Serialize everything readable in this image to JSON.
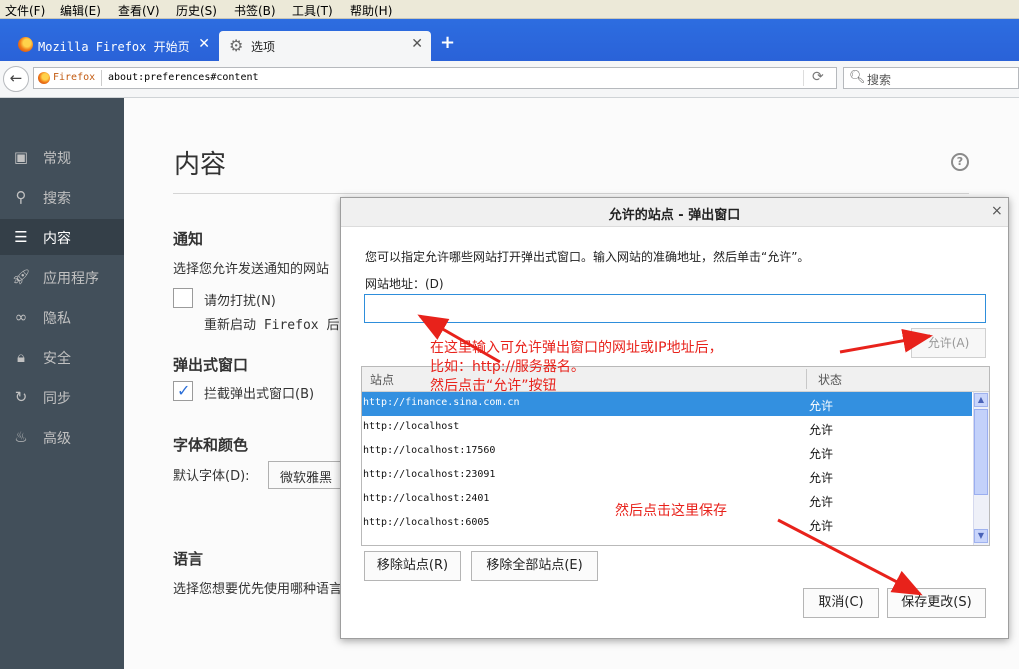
{
  "menubar": [
    "文件(F)",
    "编辑(E)",
    "查看(V)",
    "历史(S)",
    "书签(B)",
    "工具(T)",
    "帮助(H)"
  ],
  "tabs": [
    {
      "label": "Mozilla Firefox 开始页",
      "close": "✕"
    },
    {
      "label": "选项",
      "close": "✕"
    }
  ],
  "new_tab": "+",
  "navbar": {
    "identity": "Firefox",
    "url": "about:preferences#content",
    "search_placeholder": "搜索"
  },
  "sidebar": {
    "items": [
      {
        "label": "常规",
        "icon": "general-icon"
      },
      {
        "label": "搜索",
        "icon": "search-icon"
      },
      {
        "label": "内容",
        "icon": "content-icon",
        "active": true
      },
      {
        "label": "应用程序",
        "icon": "applications-icon"
      },
      {
        "label": "隐私",
        "icon": "privacy-mask-icon"
      },
      {
        "label": "安全",
        "icon": "lock-icon"
      },
      {
        "label": "同步",
        "icon": "sync-icon"
      },
      {
        "label": "高级",
        "icon": "advanced-icon"
      }
    ]
  },
  "content": {
    "title": "内容",
    "help": "?",
    "notifications": {
      "heading": "通知",
      "desc": "选择您允许发送通知的网站",
      "dnd_label": "请勿打扰(N)",
      "dnd_note": "重新启动 Firefox 后"
    },
    "popups": {
      "heading": "弹出式窗口",
      "block_label": "拦截弹出式窗口(B)"
    },
    "fonts": {
      "heading": "字体和颜色",
      "default_font_label": "默认字体(D):",
      "default_font_value": "微软雅黑"
    },
    "language": {
      "heading": "语言",
      "desc": "选择您想要优先使用哪种语言"
    }
  },
  "dialog": {
    "title": "允许的站点 - 弹出窗口",
    "close": "×",
    "description": "您可以指定允许哪些网站打开弹出式窗口。输入网站的准确地址，然后单击“允许”。",
    "address_label": "网站地址：(D)",
    "address_value": "",
    "allow_button": "允许(A)",
    "columns": [
      "站点",
      "状态"
    ],
    "rows": [
      {
        "site": "http://finance.sina.com.cn",
        "status": "允许",
        "selected": true
      },
      {
        "site": "http://localhost",
        "status": "允许"
      },
      {
        "site": "http://localhost:17560",
        "status": "允许"
      },
      {
        "site": "http://localhost:23091",
        "status": "允许"
      },
      {
        "site": "http://localhost:2401",
        "status": "允许"
      },
      {
        "site": "http://localhost:6005",
        "status": "允许"
      }
    ],
    "remove_button": "移除站点(R)",
    "remove_all_button": "移除全部站点(E)",
    "cancel_button": "取消(C)",
    "save_button": "保存更改(S)"
  },
  "annotations": {
    "line1": "在这里输入可允许弹出窗口的网址或IP地址后，",
    "line2": "比如：http://服务器名。",
    "line3": "然后点击“允许”按钮",
    "save_hint": "然后点击这里保存",
    "color": "#e8221b"
  }
}
